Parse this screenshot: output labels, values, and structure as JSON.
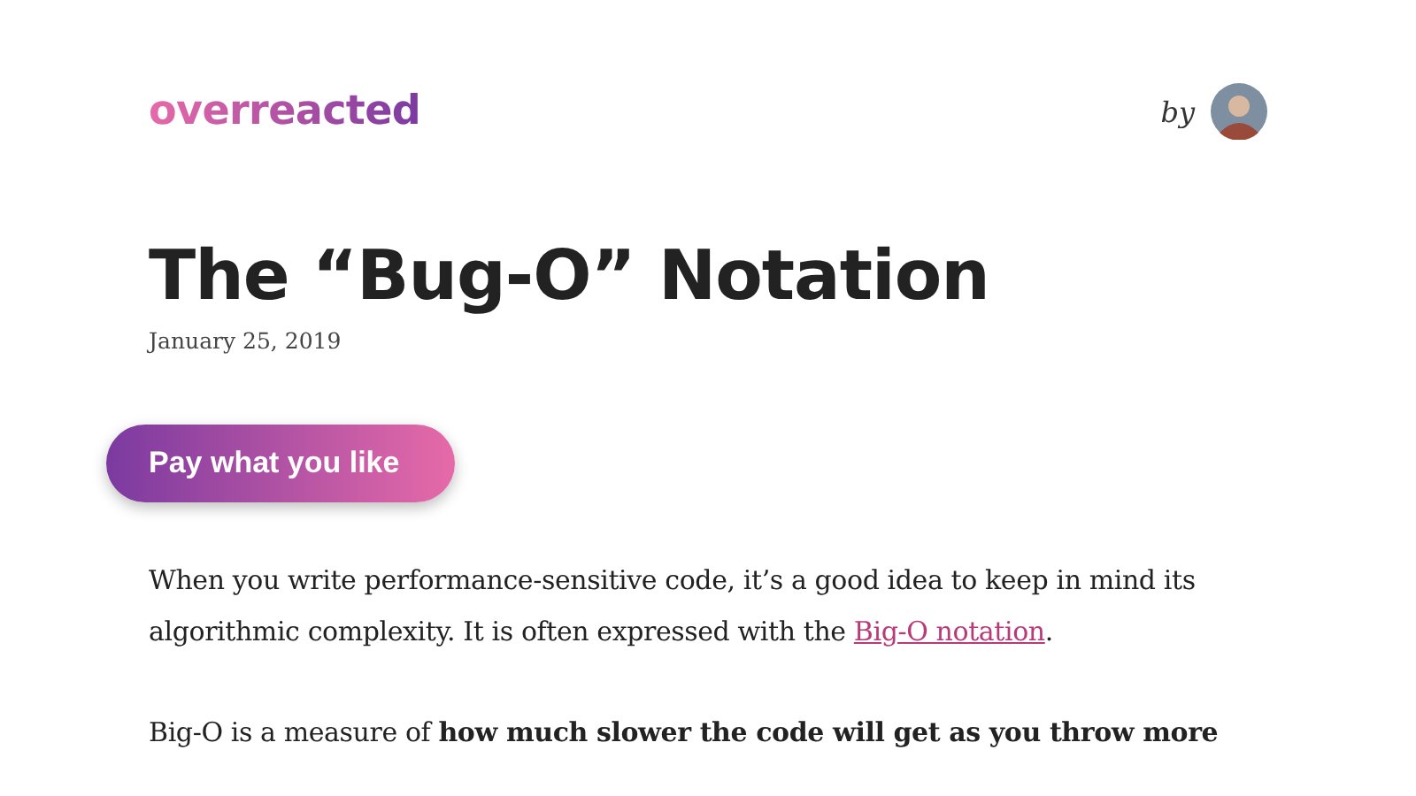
{
  "header": {
    "logo": "overreacted",
    "byline": "by"
  },
  "post": {
    "title": "The “Bug-O” Notation",
    "date": "January 25, 2019"
  },
  "pay_button": {
    "label": "Pay what you like"
  },
  "paragraphs": [
    {
      "parts": [
        {
          "kind": "text",
          "text": "When you write performance-sensitive code, it’s a good idea to keep in mind its algorithmic complexity. It is often expressed with the "
        },
        {
          "kind": "link",
          "text": "Big-O notation"
        },
        {
          "kind": "text",
          "text": "."
        }
      ]
    },
    {
      "parts": [
        {
          "kind": "text",
          "text": "Big-O is a measure of **how much slower the code will get as you throw more**"
        }
      ]
    }
  ]
}
